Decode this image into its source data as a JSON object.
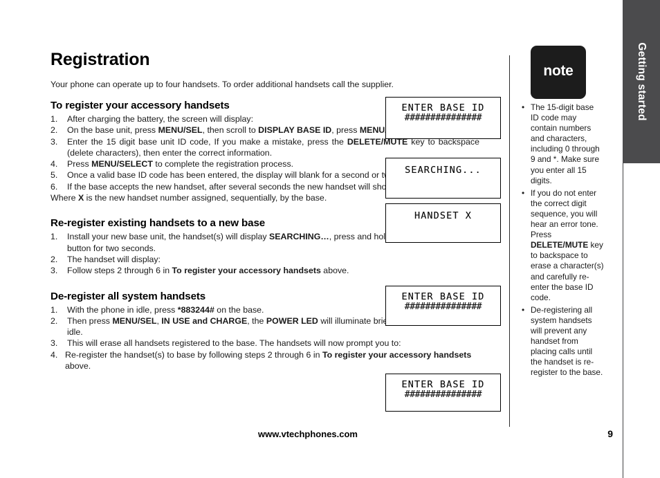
{
  "chapter_tab": {
    "label": "Getting started"
  },
  "page": {
    "title": "Registration",
    "intro": "Your phone can operate up to four handsets. To order additional handsets call the supplier."
  },
  "sections": [
    {
      "heading": "To register your accessory handsets",
      "steps": [
        {
          "num": "1.",
          "html": "After charging the battery, the screen will display:"
        },
        {
          "num": "2.",
          "html": "On the base unit, press <b>MENU/SEL</b>, then scroll to <b>DISPLAY BASE ID</b>, press <b>MENU/SEL</b>."
        },
        {
          "num": "3.",
          "html": "Enter the 15 digit base unit ID code, If you make a mistake, press the <b>DELETE/MUTE</b> key to backspace (delete characters), then enter the correct information."
        },
        {
          "num": "4.",
          "html": "Press <b>MENU/SELECT</b> to complete the registration process."
        },
        {
          "num": "5.",
          "html": "Once a valid base ID code has been entered, the display will blank for a second or two, and then show:"
        },
        {
          "num": "6.",
          "html": "If the base accepts the new handset, after several seconds the new handset will show:"
        }
      ],
      "footnote": "Where <b>X</b> is the new handset number assigned, sequentially, by the base."
    },
    {
      "heading": "Re-register existing handsets to a new base",
      "steps": [
        {
          "num": "1.",
          "html": "Install your new base unit, the handset(s) will display <b>SEARCHING…</b>, press and hold the <b>MENU/SELECT</b> button for two seconds."
        },
        {
          "num": "2.",
          "html": "The handset will display:"
        },
        {
          "num": "3.",
          "html": "Follow steps 2 through 6 in <b>To register your accessory handsets</b> above."
        }
      ],
      "footnote": ""
    },
    {
      "heading": "De-register all system handsets",
      "steps": [
        {
          "num": "1.",
          "html": "With the phone in idle, press <b>*883244#</b> on the base."
        },
        {
          "num": "2.",
          "html": "Then press <b>MENU/SEL</b>, <b>IN USE and CHARGE</b>, the <b>POWER LED</b> will illuminate briefly before returning to idle."
        },
        {
          "num": "3.",
          "html": "This will erase all handsets registered to the base. The handsets will now prompt you to:"
        },
        {
          "num": "4.",
          "html": "Re-register the handset(s) to  base by following steps 2 through 6 in <b>To register your accessory handsets</b> above."
        }
      ],
      "footnote": ""
    }
  ],
  "lcd_screens": [
    {
      "id": "lcd-1",
      "line1": "ENTER BASE ID",
      "line2": "###############"
    },
    {
      "id": "lcd-2",
      "line1": "SEARCHING...",
      "line2": ""
    },
    {
      "id": "lcd-3",
      "line1": "HANDSET X",
      "line2": ""
    },
    {
      "id": "lcd-4",
      "line1": "ENTER BASE ID",
      "line2": "###############"
    },
    {
      "id": "lcd-5",
      "line1": "ENTER BASE ID",
      "line2": "###############"
    }
  ],
  "note": {
    "badge_label": "note",
    "bullet_glyph": "•",
    "items": [
      {
        "html": "The 15-digit base ID code may contain numbers and characters, including 0 through 9 and *. Make sure you enter all 15 digits."
      },
      {
        "html": "If you do not enter the correct digit sequence, you will hear an error tone. Press <b>DELETE/MUTE</b> key to backspace to erase a character(s) and carefully re-enter the base ID code."
      },
      {
        "html": "De-registering all system handsets will prevent any handset from placing calls until the handset is re-register to the base."
      }
    ]
  },
  "footer": {
    "url": "www.vtechphones.com",
    "page_number": "9"
  },
  "colors": {
    "chapter_tab_bg": "#4b4b4d",
    "note_badge_bg": "#1c1c1c",
    "text": "#1a1a1a"
  }
}
